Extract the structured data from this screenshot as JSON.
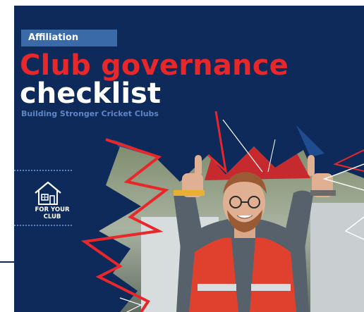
{
  "cover": {
    "tag": "Affiliation",
    "title_line1": "Club governance",
    "title_line2": "checklist",
    "subtitle": "Building Stronger Cricket Clubs"
  },
  "badge": {
    "icon": "house-icon",
    "label": "FOR YOUR\nCLUB"
  },
  "colors": {
    "navy": "#0e2a5a",
    "red": "#e8272a",
    "tag_blue": "#3a6aa8",
    "subtitle_blue": "#5f86c4"
  }
}
